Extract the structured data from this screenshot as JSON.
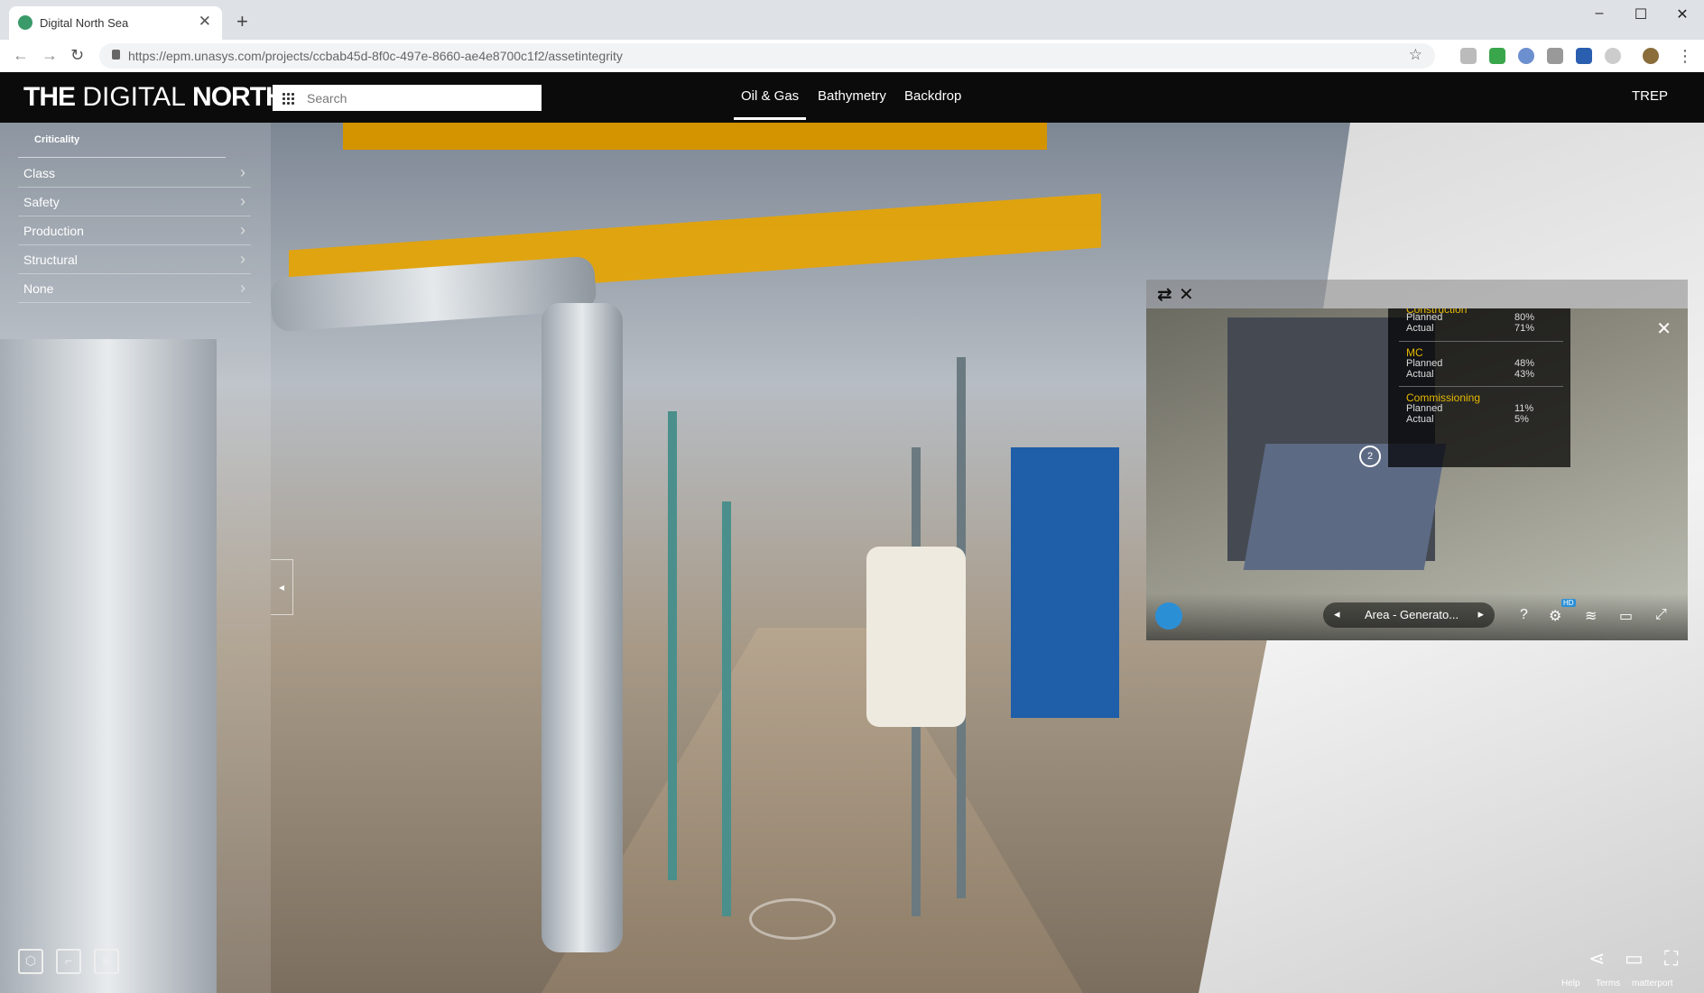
{
  "browser": {
    "tab_title": "Digital North Sea",
    "tab_close": "✕",
    "new_tab": "+",
    "url": "https://epm.unasys.com/projects/ccbab45d-8f0c-497e-8660-ae4e8700c1f2/assetintegrity",
    "window_controls": [
      "–",
      "☐",
      "✕"
    ]
  },
  "app": {
    "logo_bold1": "THE",
    "logo_light": " DIGITAL ",
    "logo_bold2": "NORTH SEA",
    "search_placeholder": "Search",
    "nav_tabs": [
      "Oil & Gas",
      "Bathymetry",
      "Backdrop"
    ],
    "active_tab": "Oil & Gas",
    "user": "TREP"
  },
  "sidebar": {
    "heading": "Criticality",
    "items": [
      {
        "label": "Class"
      },
      {
        "label": "Safety"
      },
      {
        "label": "Production"
      },
      {
        "label": "Structural"
      },
      {
        "label": "None"
      }
    ],
    "collapse_glyph": "◂"
  },
  "floating_panel": {
    "stats": [
      {
        "title": "Construction",
        "planned": "80%",
        "actual": "71%"
      },
      {
        "title": "MC",
        "planned": "48%",
        "actual": "43%"
      },
      {
        "title": "Commissioning",
        "planned": "11%",
        "actual": "5%"
      }
    ],
    "planned_label": "Planned",
    "actual_label": "Actual",
    "badge": "2",
    "area_label": "Area - Generato...",
    "help": "?",
    "hd_badge": "HD"
  },
  "footer": {
    "help": "Help",
    "terms": "Terms",
    "brand": "matterport"
  }
}
